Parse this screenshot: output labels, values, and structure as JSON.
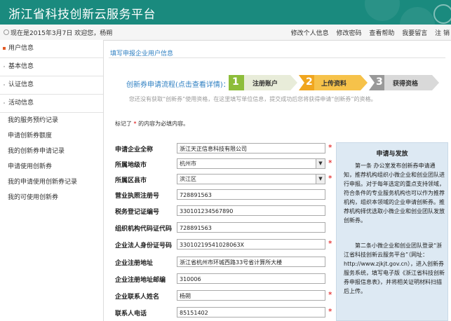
{
  "header": {
    "title": "浙江省科技创新云服务平台"
  },
  "topbar": {
    "welcome": "现在是2015年3月7日 欢迎您，杨朔",
    "links": [
      "修改个人信息",
      "修改密码",
      "查看帮助",
      "我要留言",
      "注 销"
    ]
  },
  "sidebar": {
    "sections": [
      {
        "label": "用户信息",
        "active": true
      },
      {
        "label": "基本信息",
        "active": false
      },
      {
        "label": "认证信息",
        "active": false
      },
      {
        "label": "活动信息",
        "active": false
      }
    ],
    "links": [
      "我的服务预约记录",
      "申请创新券额度",
      "我的创新券申请记录",
      "申请使用创新券",
      "我的申请使用创新券记录",
      "我的可使用创新券"
    ]
  },
  "main": {
    "page_title": "填写申报企业用户信息",
    "flow_label": "创新券申请流程(点击查看详情)：",
    "steps": [
      {
        "num": "1",
        "label": "注册账户",
        "color": "#8dbd3a"
      },
      {
        "num": "2",
        "label": "上传资料",
        "color": "#f0a61f"
      },
      {
        "num": "3",
        "label": "获得资格",
        "color": "#999999"
      }
    ],
    "hint": "您还没有获取“创新券”使用资格，在这里填写单位信息，提交成功后您将获得申请“创新券”的资格。",
    "required_note_prefix": "标记了",
    "required_star": "*",
    "required_note_suffix": "的内容为必填内容。",
    "form": [
      {
        "label": "申请企业全称",
        "value": "浙江天正信息科技有限公司",
        "type": "text",
        "required": true
      },
      {
        "label": "所属地级市",
        "value": "杭州市",
        "type": "select",
        "required": true
      },
      {
        "label": "所属区县市",
        "value": "滨江区",
        "type": "select",
        "required": true
      },
      {
        "label": "营业执照注册号",
        "value": "728891563",
        "type": "text",
        "required": false
      },
      {
        "label": "税务登记证编号",
        "value": "330101234567890",
        "type": "text",
        "required": false
      },
      {
        "label": "组织机构代码证代码",
        "value": "728891563",
        "type": "text",
        "required": false
      },
      {
        "label": "企业法人身份证号码",
        "value": "33010219541028063X",
        "type": "text",
        "required": true
      },
      {
        "label": "企业注册地址",
        "value": "浙江省杭州市环城西路33号省计算所大楼",
        "type": "text",
        "required": false
      },
      {
        "label": "企业注册地址邮编",
        "value": "310006",
        "type": "text",
        "required": false
      },
      {
        "label": "企业联系人姓名",
        "value": "杨朔",
        "type": "text",
        "required": true
      },
      {
        "label": "联系人电话",
        "value": "85151402",
        "type": "text",
        "required": true
      }
    ]
  },
  "info_box": {
    "title": "申请与发放",
    "paragraphs": [
      "第一条 办公室发布创新券申请通知，推荐机构组织小微企业和创业团队进行申报。对于每年选定的重点支持领域，符合条件的专业服务机构也可以作为推荐机构，组织本领域的企业申请创新券。推荐机构择优选取小微企业和创业团队发放创新券。",
      "第二条小微企业和创业团队登录“浙江省科技创新云服务平台”（网址：http://www.zjkjt.gov.cn），进入创新券服务系统，填写电子版《浙江省科技创新券申报信息表》，并将相关证明材料扫描后上传。"
    ]
  },
  "colors": {
    "banner": "#1a8a7e",
    "link_blue": "#2e7fc2",
    "required_red": "#dd0000",
    "info_bg": "#dde9f3"
  }
}
